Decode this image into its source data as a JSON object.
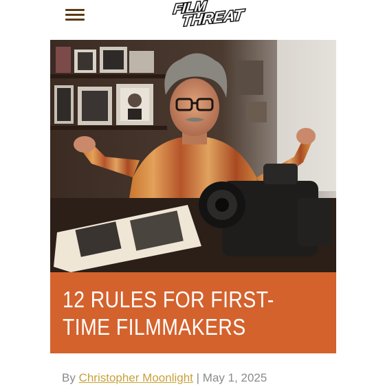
{
  "header": {
    "menu_icon": "hamburger-menu-icon",
    "logo_text_line1": "FILM",
    "logo_text_line2": "THREAT"
  },
  "article": {
    "title": "12 RULES FOR FIRST-TIME FILMMAKERS",
    "byline_prefix": "By",
    "author": "Christopher Moonlight",
    "separator": "|",
    "date": "May 1, 2025"
  },
  "colors": {
    "accent": "#d4622d",
    "author_link": "#c8a13a",
    "menu_icon": "#5a3a14"
  }
}
